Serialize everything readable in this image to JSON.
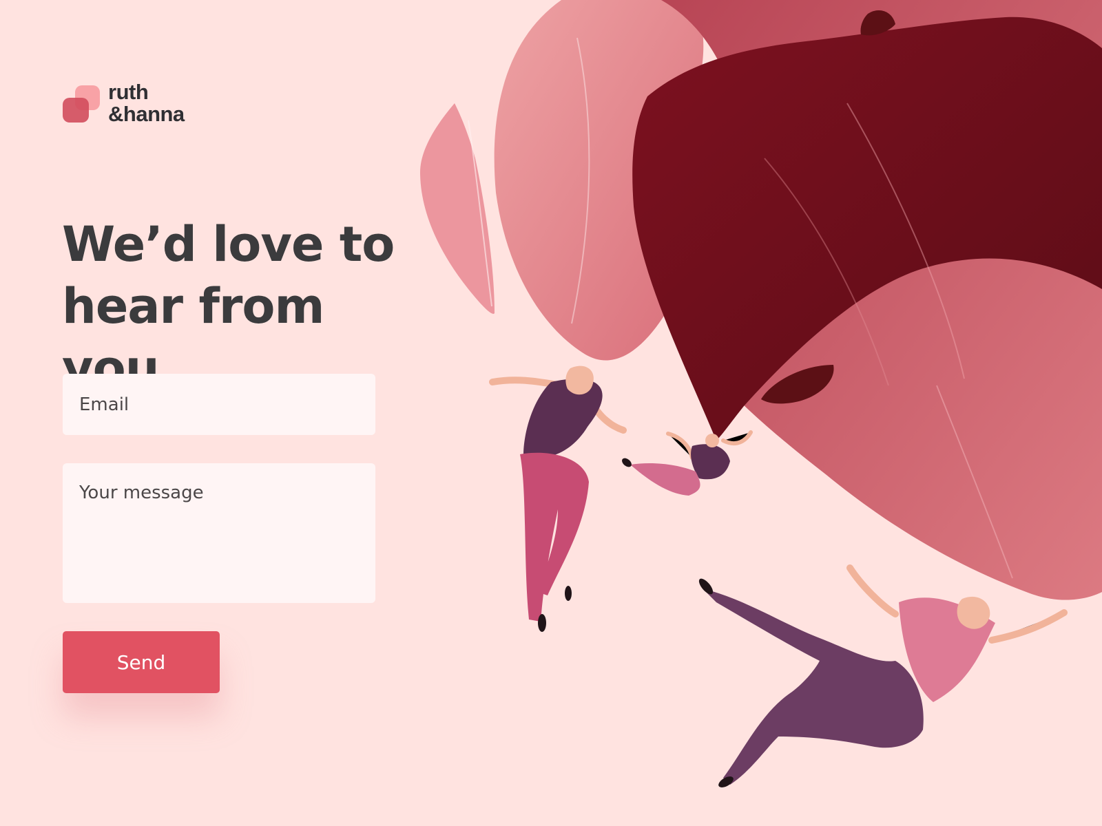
{
  "logo": {
    "line1": "ruth",
    "line2": "&hanna"
  },
  "headline": "We’d love to hear from you.",
  "form": {
    "email_placeholder": "Email",
    "message_placeholder": "Your message",
    "send_label": "Send"
  },
  "colors": {
    "background": "#ffe3e0",
    "accent": "#e15262",
    "field": "#fff5f5",
    "text": "#3b3b3d"
  }
}
